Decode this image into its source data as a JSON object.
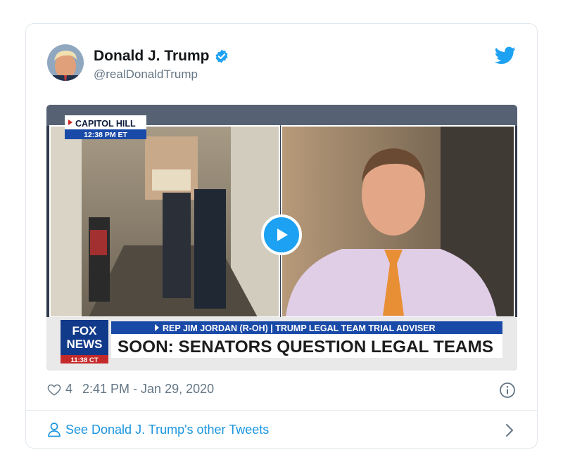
{
  "tweet": {
    "display_name": "Donald J. Trump",
    "handle": "@realDonaldTrump",
    "likes": "4",
    "timestamp": "2:41 PM - Jan 29, 2020",
    "footer_link": "See Donald J. Trump's other Tweets"
  },
  "video": {
    "location_label": "CAPITOL HILL",
    "location_time": "12:38 PM ET",
    "lower_third_top": "REP JIM JORDAN (R-OH) | TRUMP LEGAL TEAM TRIAL ADVISER",
    "lower_third_main": "SOON: SENATORS QUESTION LEGAL TEAMS",
    "network_logo_line1": "FOX",
    "network_logo_line2": "NEWS",
    "network_time": "11:38 CT"
  },
  "icons": {
    "verified": "verified-badge-icon",
    "platform": "twitter-bird-icon",
    "play": "play-icon",
    "like": "heart-icon",
    "info": "info-icon",
    "user": "user-icon",
    "chevron": "chevron-right-icon"
  },
  "colors": {
    "accent": "#1da1f2",
    "link": "#1b95e0",
    "muted": "#657786",
    "name": "#14171a",
    "border": "#e1e8ed"
  }
}
